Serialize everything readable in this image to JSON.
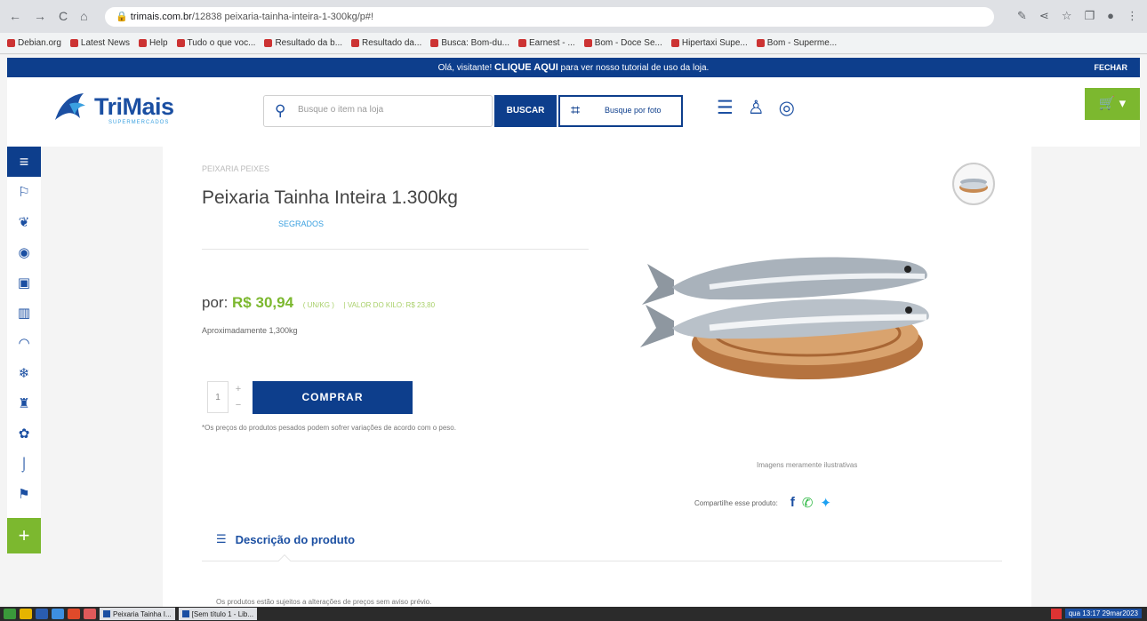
{
  "browser": {
    "url_host": "trimais.com.br",
    "url_path": "/12838 peixaria-tainha-inteira-1-300kg/p#!",
    "bookmarks": [
      "Debian.org",
      "Latest News",
      "Help",
      "Tudo o que voc...",
      "Resultado da b...",
      "Resultado da...",
      "Busca: Bom-du...",
      "Earnest - ...",
      "Bom - Doce Se...",
      "Hipertaxi Supe...",
      "Bom - Superme..."
    ]
  },
  "banner": {
    "pre": "Olá, visitante!",
    "cta": "CLIQUE AQUI",
    "post": " para ver nosso tutorial de uso da loja.",
    "close": "FECHAR"
  },
  "header": {
    "brand": "TriMais",
    "brand_sub": "SUPERMERCADOS",
    "search_placeholder": "Busque o item na loja",
    "search_button": "BUSCAR",
    "photo_search": "Busque por foto"
  },
  "product": {
    "breadcrumb": "PEIXARIA PEIXES",
    "title": "Peixaria Tainha Inteira 1.300kg",
    "brand": "SEGRADOS",
    "price_prefix": "por: ",
    "price": "R$ 30,94",
    "unit_note": "( UN/KG )",
    "per_kg": "| VALOR DO KILO: R$ 23,80",
    "approx": "Aproximadamente 1,300kg",
    "quantity": "1",
    "buy_button": "COMPRAR",
    "disclaimer": "*Os preços do produtos pesados podem sofrer variações de acordo com o peso.",
    "image_note": "Imagens meramente ilustrativas",
    "share_label": "Compartilhe esse produto:",
    "description_tab": "Descrição do produto",
    "description_text": "Os produtos estão sujeitos a alterações de preços sem aviso prévio."
  },
  "taskbar": {
    "windows": [
      "Peixaria Tainha I...",
      "[Sem título 1 - Lib..."
    ],
    "clock": "qua 13:17 29mar2023"
  },
  "colors": {
    "primary": "#0d3e8c",
    "accent": "#7cb82f",
    "link": "#3aa0e0"
  }
}
